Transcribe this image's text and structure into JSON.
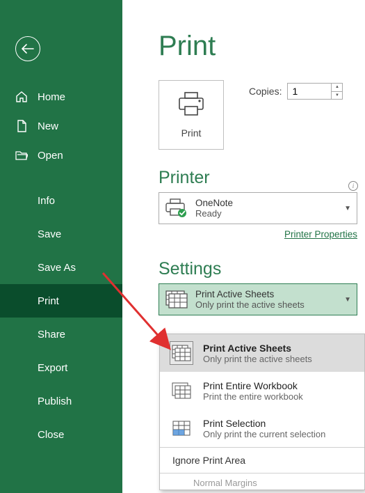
{
  "sidebar": {
    "nav": [
      {
        "label": "Home"
      },
      {
        "label": "New"
      },
      {
        "label": "Open"
      }
    ],
    "sub": [
      {
        "label": "Info"
      },
      {
        "label": "Save"
      },
      {
        "label": "Save As"
      },
      {
        "label": "Print"
      },
      {
        "label": "Share"
      },
      {
        "label": "Export"
      },
      {
        "label": "Publish"
      },
      {
        "label": "Close"
      }
    ]
  },
  "main": {
    "title": "Print",
    "print_button": "Print",
    "copies_label": "Copies:",
    "copies_value": "1",
    "printer_heading": "Printer",
    "printer": {
      "name": "OneNote",
      "status": "Ready"
    },
    "printer_props": "Printer Properties",
    "settings_heading": "Settings",
    "active_dropdown": {
      "title": "Print Active Sheets",
      "sub": "Only print the active sheets"
    }
  },
  "popup": {
    "options": [
      {
        "title": "Print Active Sheets",
        "sub": "Only print the active sheets"
      },
      {
        "title": "Print Entire Workbook",
        "sub": "Print the entire workbook"
      },
      {
        "title": "Print Selection",
        "sub": "Only print the current selection"
      }
    ],
    "ignore": "Ignore Print Area",
    "margins": "Normal Margins"
  }
}
